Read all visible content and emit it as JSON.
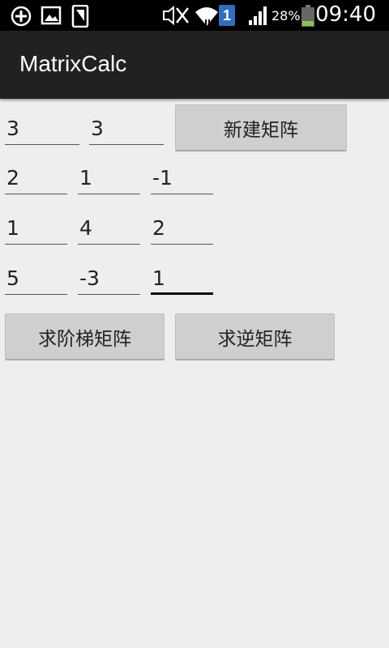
{
  "status_bar": {
    "time": "09:40",
    "battery_percent": "28%",
    "sim_slot": "1",
    "icons": [
      "add-circle-icon",
      "image-icon",
      "phone-icon",
      "mute-icon",
      "wifi-icon",
      "sim-icon",
      "signal-icon",
      "battery-icon"
    ]
  },
  "app": {
    "title": "MatrixCalc"
  },
  "dimensions": {
    "rows": "3",
    "cols": "3"
  },
  "buttons": {
    "new_matrix": "新建矩阵",
    "echelon": "求阶梯矩阵",
    "inverse": "求逆矩阵"
  },
  "matrix": [
    [
      "2",
      "1",
      "-1"
    ],
    [
      "1",
      "4",
      "2"
    ],
    [
      "5",
      "-3",
      "1"
    ]
  ],
  "colors": {
    "status_bar_bg": "#000000",
    "action_bar_bg": "#212121",
    "page_bg": "#eeeeee",
    "button_bg": "#cfcfcf",
    "battery_level": "#8bc34a"
  }
}
